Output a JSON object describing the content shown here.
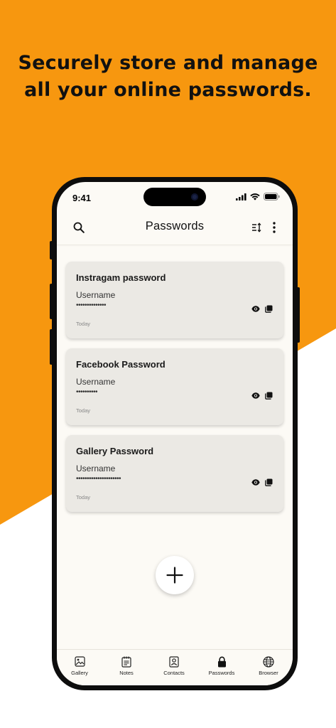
{
  "headline": {
    "line1": "Securely store and manage",
    "line2": "all your online passwords."
  },
  "status_bar": {
    "time": "9:41"
  },
  "app_bar": {
    "title": "Passwords",
    "left_icon": "search-icon",
    "right_icons": [
      "sort-icon",
      "more-vert-icon"
    ]
  },
  "passwords": [
    {
      "title": "Instragam password",
      "username_label": "Username",
      "masked_password": "••••••••••••••",
      "date": "Today"
    },
    {
      "title": "Facebook Password",
      "username_label": "Username",
      "masked_password": "••••••••••",
      "date": "Today"
    },
    {
      "title": "Gallery Password",
      "username_label": "Username",
      "masked_password": "•••••••••••••••••••••",
      "date": "Today"
    }
  ],
  "fab": {
    "icon": "plus-icon"
  },
  "bottom_nav": [
    {
      "label": "Gallery",
      "icon": "image-icon"
    },
    {
      "label": "Notes",
      "icon": "notes-icon"
    },
    {
      "label": "Contacts",
      "icon": "contact-icon"
    },
    {
      "label": "Passwords",
      "icon": "lock-icon",
      "active": true
    },
    {
      "label": "Browser",
      "icon": "globe-icon"
    }
  ],
  "colors": {
    "background_accent": "#F7970F",
    "screen_background": "#FCFAF5",
    "card_background": "#EBE9E4"
  }
}
